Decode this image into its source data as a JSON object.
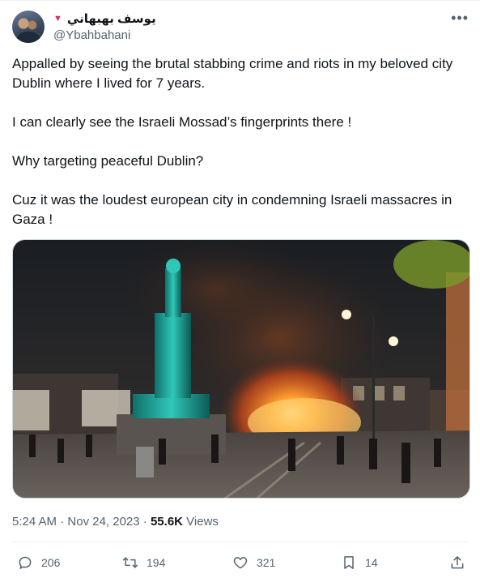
{
  "author": {
    "display_name": "يوسف بهبهاني",
    "badge_icon": "heart-icon",
    "handle": "@Ybahbahani"
  },
  "tweet": {
    "paragraphs": [
      "Appalled by seeing the brutal stabbing crime and riots in my beloved city Dublin where I lived for 7 years.",
      "I can clearly see the Israeli Mossad’s fingerprints there !",
      "Why targeting peaceful Dublin?",
      "Cuz it was the loudest european city in condemning Israeli massacres in Gaza !"
    ]
  },
  "meta": {
    "time": "5:24 AM",
    "separator": "·",
    "date": "Nov 24, 2023",
    "views_count": "55.6K",
    "views_label": "Views"
  },
  "actions": {
    "replies": "206",
    "retweets": "194",
    "likes": "321",
    "bookmarks": "14"
  },
  "colors": {
    "text": "#0f1419",
    "secondary": "#536471",
    "heart": "#e0245e"
  }
}
